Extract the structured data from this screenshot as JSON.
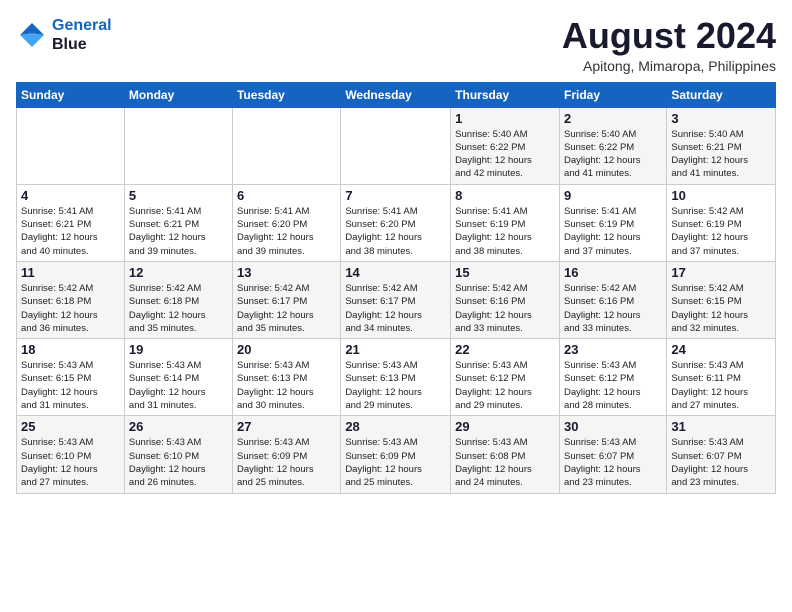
{
  "header": {
    "logo_line1": "General",
    "logo_line2": "Blue",
    "title": "August 2024",
    "subtitle": "Apitong, Mimaropa, Philippines"
  },
  "weekdays": [
    "Sunday",
    "Monday",
    "Tuesday",
    "Wednesday",
    "Thursday",
    "Friday",
    "Saturday"
  ],
  "weeks": [
    [
      {
        "day": "",
        "info": ""
      },
      {
        "day": "",
        "info": ""
      },
      {
        "day": "",
        "info": ""
      },
      {
        "day": "",
        "info": ""
      },
      {
        "day": "1",
        "info": "Sunrise: 5:40 AM\nSunset: 6:22 PM\nDaylight: 12 hours\nand 42 minutes."
      },
      {
        "day": "2",
        "info": "Sunrise: 5:40 AM\nSunset: 6:22 PM\nDaylight: 12 hours\nand 41 minutes."
      },
      {
        "day": "3",
        "info": "Sunrise: 5:40 AM\nSunset: 6:21 PM\nDaylight: 12 hours\nand 41 minutes."
      }
    ],
    [
      {
        "day": "4",
        "info": "Sunrise: 5:41 AM\nSunset: 6:21 PM\nDaylight: 12 hours\nand 40 minutes."
      },
      {
        "day": "5",
        "info": "Sunrise: 5:41 AM\nSunset: 6:21 PM\nDaylight: 12 hours\nand 39 minutes."
      },
      {
        "day": "6",
        "info": "Sunrise: 5:41 AM\nSunset: 6:20 PM\nDaylight: 12 hours\nand 39 minutes."
      },
      {
        "day": "7",
        "info": "Sunrise: 5:41 AM\nSunset: 6:20 PM\nDaylight: 12 hours\nand 38 minutes."
      },
      {
        "day": "8",
        "info": "Sunrise: 5:41 AM\nSunset: 6:19 PM\nDaylight: 12 hours\nand 38 minutes."
      },
      {
        "day": "9",
        "info": "Sunrise: 5:41 AM\nSunset: 6:19 PM\nDaylight: 12 hours\nand 37 minutes."
      },
      {
        "day": "10",
        "info": "Sunrise: 5:42 AM\nSunset: 6:19 PM\nDaylight: 12 hours\nand 37 minutes."
      }
    ],
    [
      {
        "day": "11",
        "info": "Sunrise: 5:42 AM\nSunset: 6:18 PM\nDaylight: 12 hours\nand 36 minutes."
      },
      {
        "day": "12",
        "info": "Sunrise: 5:42 AM\nSunset: 6:18 PM\nDaylight: 12 hours\nand 35 minutes."
      },
      {
        "day": "13",
        "info": "Sunrise: 5:42 AM\nSunset: 6:17 PM\nDaylight: 12 hours\nand 35 minutes."
      },
      {
        "day": "14",
        "info": "Sunrise: 5:42 AM\nSunset: 6:17 PM\nDaylight: 12 hours\nand 34 minutes."
      },
      {
        "day": "15",
        "info": "Sunrise: 5:42 AM\nSunset: 6:16 PM\nDaylight: 12 hours\nand 33 minutes."
      },
      {
        "day": "16",
        "info": "Sunrise: 5:42 AM\nSunset: 6:16 PM\nDaylight: 12 hours\nand 33 minutes."
      },
      {
        "day": "17",
        "info": "Sunrise: 5:42 AM\nSunset: 6:15 PM\nDaylight: 12 hours\nand 32 minutes."
      }
    ],
    [
      {
        "day": "18",
        "info": "Sunrise: 5:43 AM\nSunset: 6:15 PM\nDaylight: 12 hours\nand 31 minutes."
      },
      {
        "day": "19",
        "info": "Sunrise: 5:43 AM\nSunset: 6:14 PM\nDaylight: 12 hours\nand 31 minutes."
      },
      {
        "day": "20",
        "info": "Sunrise: 5:43 AM\nSunset: 6:13 PM\nDaylight: 12 hours\nand 30 minutes."
      },
      {
        "day": "21",
        "info": "Sunrise: 5:43 AM\nSunset: 6:13 PM\nDaylight: 12 hours\nand 29 minutes."
      },
      {
        "day": "22",
        "info": "Sunrise: 5:43 AM\nSunset: 6:12 PM\nDaylight: 12 hours\nand 29 minutes."
      },
      {
        "day": "23",
        "info": "Sunrise: 5:43 AM\nSunset: 6:12 PM\nDaylight: 12 hours\nand 28 minutes."
      },
      {
        "day": "24",
        "info": "Sunrise: 5:43 AM\nSunset: 6:11 PM\nDaylight: 12 hours\nand 27 minutes."
      }
    ],
    [
      {
        "day": "25",
        "info": "Sunrise: 5:43 AM\nSunset: 6:10 PM\nDaylight: 12 hours\nand 27 minutes."
      },
      {
        "day": "26",
        "info": "Sunrise: 5:43 AM\nSunset: 6:10 PM\nDaylight: 12 hours\nand 26 minutes."
      },
      {
        "day": "27",
        "info": "Sunrise: 5:43 AM\nSunset: 6:09 PM\nDaylight: 12 hours\nand 25 minutes."
      },
      {
        "day": "28",
        "info": "Sunrise: 5:43 AM\nSunset: 6:09 PM\nDaylight: 12 hours\nand 25 minutes."
      },
      {
        "day": "29",
        "info": "Sunrise: 5:43 AM\nSunset: 6:08 PM\nDaylight: 12 hours\nand 24 minutes."
      },
      {
        "day": "30",
        "info": "Sunrise: 5:43 AM\nSunset: 6:07 PM\nDaylight: 12 hours\nand 23 minutes."
      },
      {
        "day": "31",
        "info": "Sunrise: 5:43 AM\nSunset: 6:07 PM\nDaylight: 12 hours\nand 23 minutes."
      }
    ]
  ]
}
